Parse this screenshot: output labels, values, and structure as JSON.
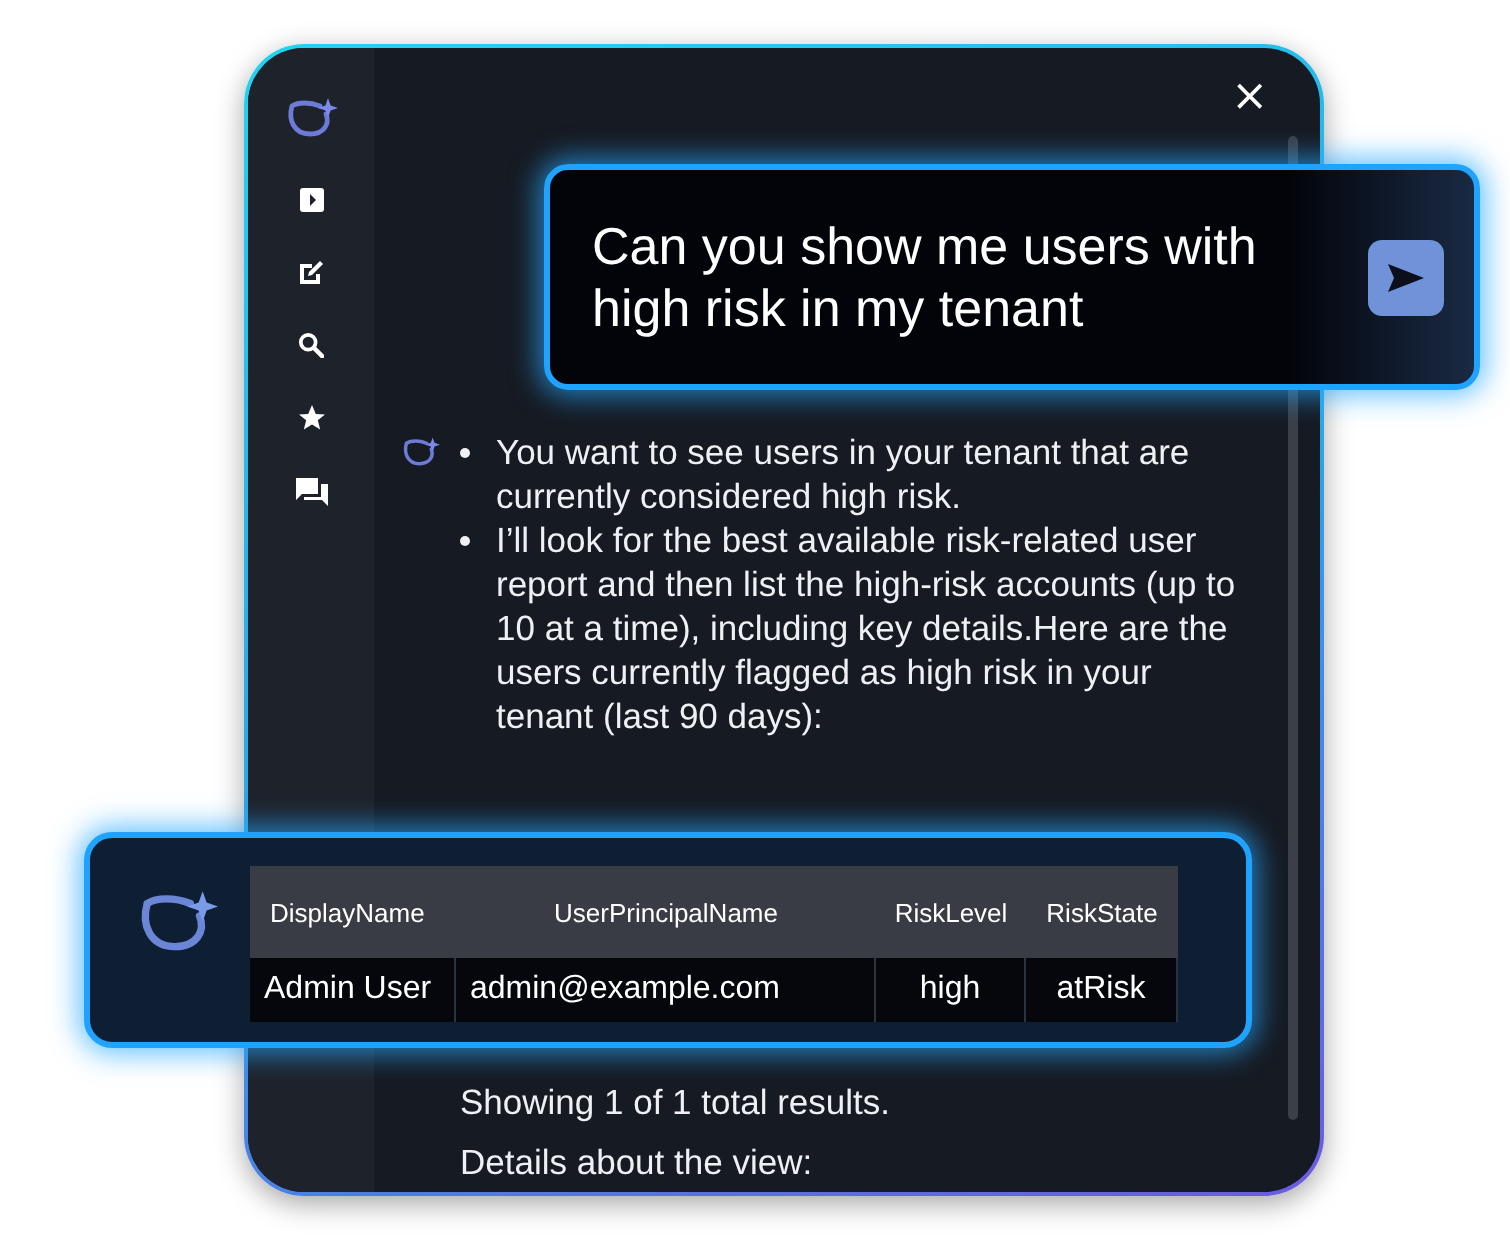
{
  "panel": {
    "close": "×"
  },
  "prompt": {
    "text": "Can you show me users with high risk in my tenant"
  },
  "response": {
    "bullets": [
      "You want to see users in your tenant that are currently considered high risk.",
      "I’ll look for the best available risk-related user report and then list the high-risk accounts (up to 10 at a time), including key details.Here are the users currently flagged as high risk in your tenant (last 90 days):"
    ]
  },
  "table": {
    "columns": [
      "DisplayName",
      "UserPrincipalName",
      "RiskLevel",
      "RiskState"
    ],
    "rows": [
      [
        "Admin User",
        "admin@example.com",
        "high",
        "atRisk"
      ]
    ]
  },
  "footer": [
    "Showing 1 of 1 total results.",
    "Details about the view:"
  ]
}
